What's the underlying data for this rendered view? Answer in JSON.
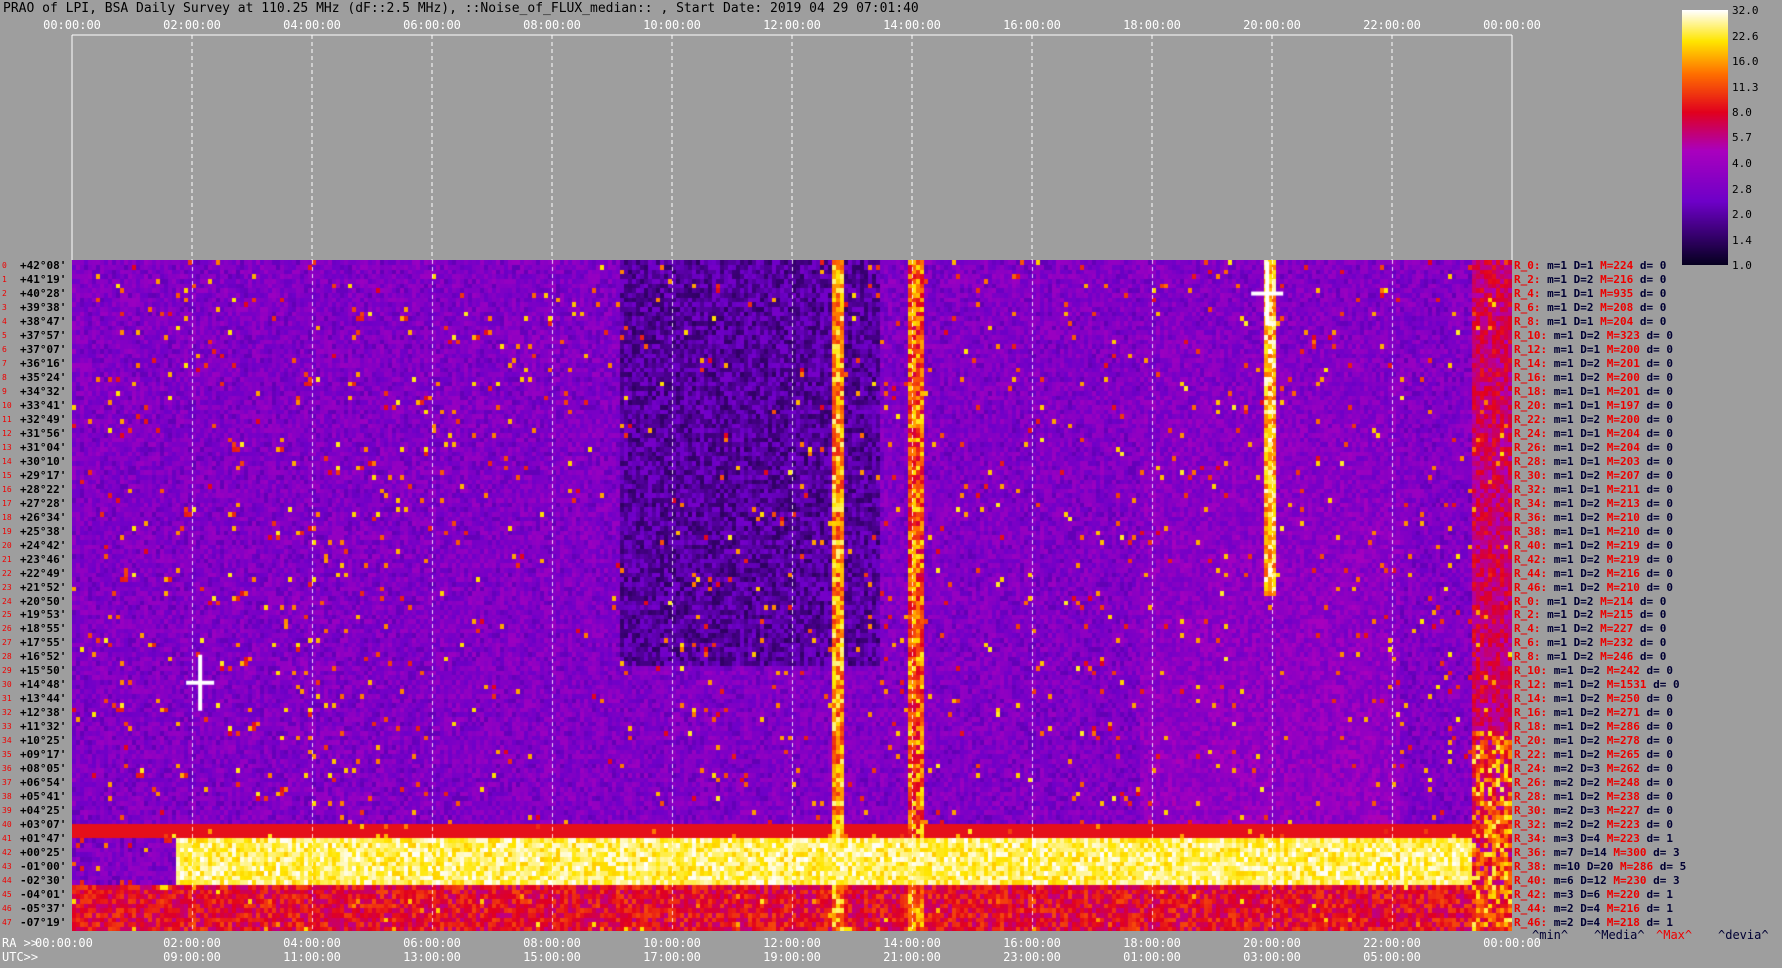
{
  "title": "PRAO of LPI, BSA Daily Survey at 110.25 MHz (dF::2.5 MHz), ::Noise_of_FLUX_median:: , Start Date: 2019 04 29 07:01:40",
  "chart_data": {
    "type": "heatmap",
    "x_top_ticks": [
      "00:00:00",
      "02:00:00",
      "04:00:00",
      "06:00:00",
      "08:00:00",
      "10:00:00",
      "12:00:00",
      "14:00:00",
      "16:00:00",
      "18:00:00",
      "20:00:00",
      "22:00:00",
      "00:00:00"
    ],
    "x_bottom_ra_ticks": [
      "00:00:00",
      "02:00:00",
      "04:00:00",
      "06:00:00",
      "08:00:00",
      "10:00:00",
      "12:00:00",
      "14:00:00",
      "16:00:00",
      "18:00:00",
      "20:00:00",
      "22:00:00",
      "00:00:00"
    ],
    "x_bottom_utc_ticks": [
      "09:00:00",
      "11:00:00",
      "13:00:00",
      "15:00:00",
      "17:00:00",
      "19:00:00",
      "21:00:00",
      "23:00:00",
      "01:00:00",
      "03:00:00",
      "05:00:00"
    ],
    "x_ra_label": "RA >>",
    "x_utc_label": "UTC>>",
    "y_declinations": [
      "+42°08'",
      "+41°19'",
      "+40°28'",
      "+39°38'",
      "+38°47'",
      "+37°57'",
      "+37°07'",
      "+36°16'",
      "+35°24'",
      "+34°32'",
      "+33°41'",
      "+32°49'",
      "+31°56'",
      "+31°04'",
      "+30°10'",
      "+29°17'",
      "+28°22'",
      "+27°28'",
      "+26°34'",
      "+25°38'",
      "+24°42'",
      "+23°46'",
      "+22°49'",
      "+21°52'",
      "+20°50'",
      "+19°53'",
      "+18°55'",
      "+17°55'",
      "+16°52'",
      "+15°50'",
      "+14°48'",
      "+13°44'",
      "+12°38'",
      "+11°32'",
      "+10°25'",
      "+09°17'",
      "+08°05'",
      "+06°54'",
      "+05°41'",
      "+04°25'",
      "+03°07'",
      "+01°47'",
      "+00°25'",
      "-01°00'",
      "-02°30'",
      "-04°01'",
      "-05°37'",
      "-07°19'"
    ],
    "row_stats": [
      {
        "r": "R_0:",
        "m": "1",
        "D": "1",
        "M": "224",
        "d": "0"
      },
      {
        "r": "R_2:",
        "m": "1",
        "D": "2",
        "M": "216",
        "d": "0"
      },
      {
        "r": "R_4:",
        "m": "1",
        "D": "1",
        "M": "935",
        "d": "0"
      },
      {
        "r": "R_6:",
        "m": "1",
        "D": "2",
        "M": "208",
        "d": "0"
      },
      {
        "r": "R_8:",
        "m": "1",
        "D": "1",
        "M": "204",
        "d": "0"
      },
      {
        "r": "R_10:",
        "m": "1",
        "D": "2",
        "M": "323",
        "d": "0"
      },
      {
        "r": "R_12:",
        "m": "1",
        "D": "1",
        "M": "200",
        "d": "0"
      },
      {
        "r": "R_14:",
        "m": "1",
        "D": "2",
        "M": "201",
        "d": "0"
      },
      {
        "r": "R_16:",
        "m": "1",
        "D": "2",
        "M": "200",
        "d": "0"
      },
      {
        "r": "R_18:",
        "m": "1",
        "D": "1",
        "M": "201",
        "d": "0"
      },
      {
        "r": "R_20:",
        "m": "1",
        "D": "1",
        "M": "197",
        "d": "0"
      },
      {
        "r": "R_22:",
        "m": "1",
        "D": "2",
        "M": "200",
        "d": "0"
      },
      {
        "r": "R_24:",
        "m": "1",
        "D": "1",
        "M": "204",
        "d": "0"
      },
      {
        "r": "R_26:",
        "m": "1",
        "D": "2",
        "M": "204",
        "d": "0"
      },
      {
        "r": "R_28:",
        "m": "1",
        "D": "1",
        "M": "203",
        "d": "0"
      },
      {
        "r": "R_30:",
        "m": "1",
        "D": "2",
        "M": "207",
        "d": "0"
      },
      {
        "r": "R_32:",
        "m": "1",
        "D": "1",
        "M": "211",
        "d": "0"
      },
      {
        "r": "R_34:",
        "m": "1",
        "D": "2",
        "M": "213",
        "d": "0"
      },
      {
        "r": "R_36:",
        "m": "1",
        "D": "2",
        "M": "210",
        "d": "0"
      },
      {
        "r": "R_38:",
        "m": "1",
        "D": "1",
        "M": "210",
        "d": "0"
      },
      {
        "r": "R_40:",
        "m": "1",
        "D": "2",
        "M": "219",
        "d": "0"
      },
      {
        "r": "R_42:",
        "m": "1",
        "D": "2",
        "M": "219",
        "d": "0"
      },
      {
        "r": "R_44:",
        "m": "1",
        "D": "2",
        "M": "216",
        "d": "0"
      },
      {
        "r": "R_46:",
        "m": "1",
        "D": "2",
        "M": "210",
        "d": "0"
      },
      {
        "r": "R_0:",
        "m": "1",
        "D": "2",
        "M": "214",
        "d": "0"
      },
      {
        "r": "R_2:",
        "m": "1",
        "D": "2",
        "M": "215",
        "d": "0"
      },
      {
        "r": "R_4:",
        "m": "1",
        "D": "2",
        "M": "227",
        "d": "0"
      },
      {
        "r": "R_6:",
        "m": "1",
        "D": "2",
        "M": "232",
        "d": "0"
      },
      {
        "r": "R_8:",
        "m": "1",
        "D": "2",
        "M": "246",
        "d": "0"
      },
      {
        "r": "R_10:",
        "m": "1",
        "D": "2",
        "M": "242",
        "d": "0"
      },
      {
        "r": "R_12:",
        "m": "1",
        "D": "2",
        "M": "1531",
        "d": "0"
      },
      {
        "r": "R_14:",
        "m": "1",
        "D": "2",
        "M": "250",
        "d": "0"
      },
      {
        "r": "R_16:",
        "m": "1",
        "D": "2",
        "M": "271",
        "d": "0"
      },
      {
        "r": "R_18:",
        "m": "1",
        "D": "2",
        "M": "286",
        "d": "0"
      },
      {
        "r": "R_20:",
        "m": "1",
        "D": "2",
        "M": "278",
        "d": "0"
      },
      {
        "r": "R_22:",
        "m": "1",
        "D": "2",
        "M": "265",
        "d": "0"
      },
      {
        "r": "R_24:",
        "m": "2",
        "D": "3",
        "M": "262",
        "d": "0"
      },
      {
        "r": "R_26:",
        "m": "2",
        "D": "2",
        "M": "248",
        "d": "0"
      },
      {
        "r": "R_28:",
        "m": "1",
        "D": "2",
        "M": "238",
        "d": "0"
      },
      {
        "r": "R_30:",
        "m": "2",
        "D": "3",
        "M": "227",
        "d": "0"
      },
      {
        "r": "R_32:",
        "m": "2",
        "D": "2",
        "M": "223",
        "d": "0"
      },
      {
        "r": "R_34:",
        "m": "3",
        "D": "4",
        "M": "223",
        "d": "1"
      },
      {
        "r": "R_36:",
        "m": "7",
        "D": "14",
        "M": "300",
        "d": "3"
      },
      {
        "r": "R_38:",
        "m": "10",
        "D": "20",
        "M": "286",
        "d": "5"
      },
      {
        "r": "R_40:",
        "m": "6",
        "D": "12",
        "M": "230",
        "d": "3"
      },
      {
        "r": "R_42:",
        "m": "3",
        "D": "6",
        "M": "220",
        "d": "1"
      },
      {
        "r": "R_44:",
        "m": "2",
        "D": "4",
        "M": "216",
        "d": "1"
      },
      {
        "r": "R_46:",
        "m": "2",
        "D": "4",
        "M": "218",
        "d": "1"
      }
    ],
    "colorbar_ticks": [
      "32.0",
      "22.6",
      "16.0",
      "11.3",
      "8.0",
      "5.7",
      "4.0",
      "2.8",
      "2.0",
      "1.4",
      "1.0"
    ],
    "colorbar_range": [
      1.0,
      32.0
    ],
    "colorbar_scale": "log",
    "legend_footer": [
      "^min^",
      "^Media^",
      "^Max^",
      "^devia^"
    ],
    "colors": {
      "background": "#9e9e9e",
      "accent_red": "#e00000",
      "dark_text": "#000033"
    }
  }
}
